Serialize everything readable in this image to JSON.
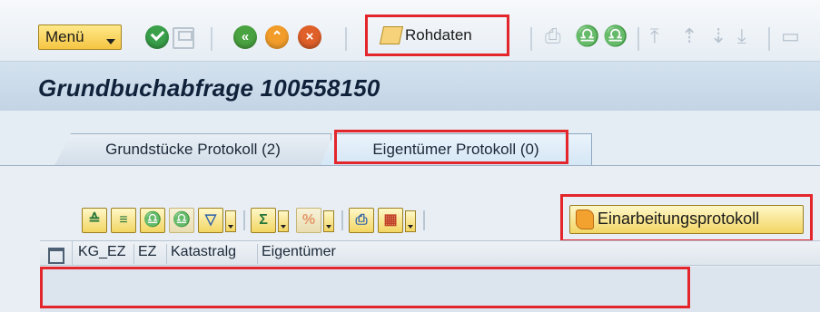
{
  "toolbar": {
    "menu_label": "Menü",
    "rohdaten_label": "Rohdaten",
    "icons": [
      "check-icon",
      "save-icon",
      "back-icon",
      "exit-icon",
      "cancel-icon",
      "print-icon",
      "find-icon",
      "find-next-icon",
      "first-page-icon",
      "previous-page-icon",
      "next-page-icon",
      "last-page-icon"
    ]
  },
  "title": "Grundbuchabfrage 100558150",
  "tabs": [
    {
      "label": "Grundstücke Protokoll (2)",
      "active": false
    },
    {
      "label": "Eigentümer Protokoll (0)",
      "active": true
    }
  ],
  "alv_toolbar": {
    "einarbeitungsprotokoll_label": "Einarbeitungsprotokoll"
  },
  "table": {
    "columns": [
      "KG_EZ",
      "EZ",
      "Katastralg",
      "Eigentümer"
    ],
    "rows": []
  },
  "colors": {
    "highlight": "#e3262b",
    "button_yellow": "#f2d563",
    "title_bg": "#c3d4e5"
  }
}
